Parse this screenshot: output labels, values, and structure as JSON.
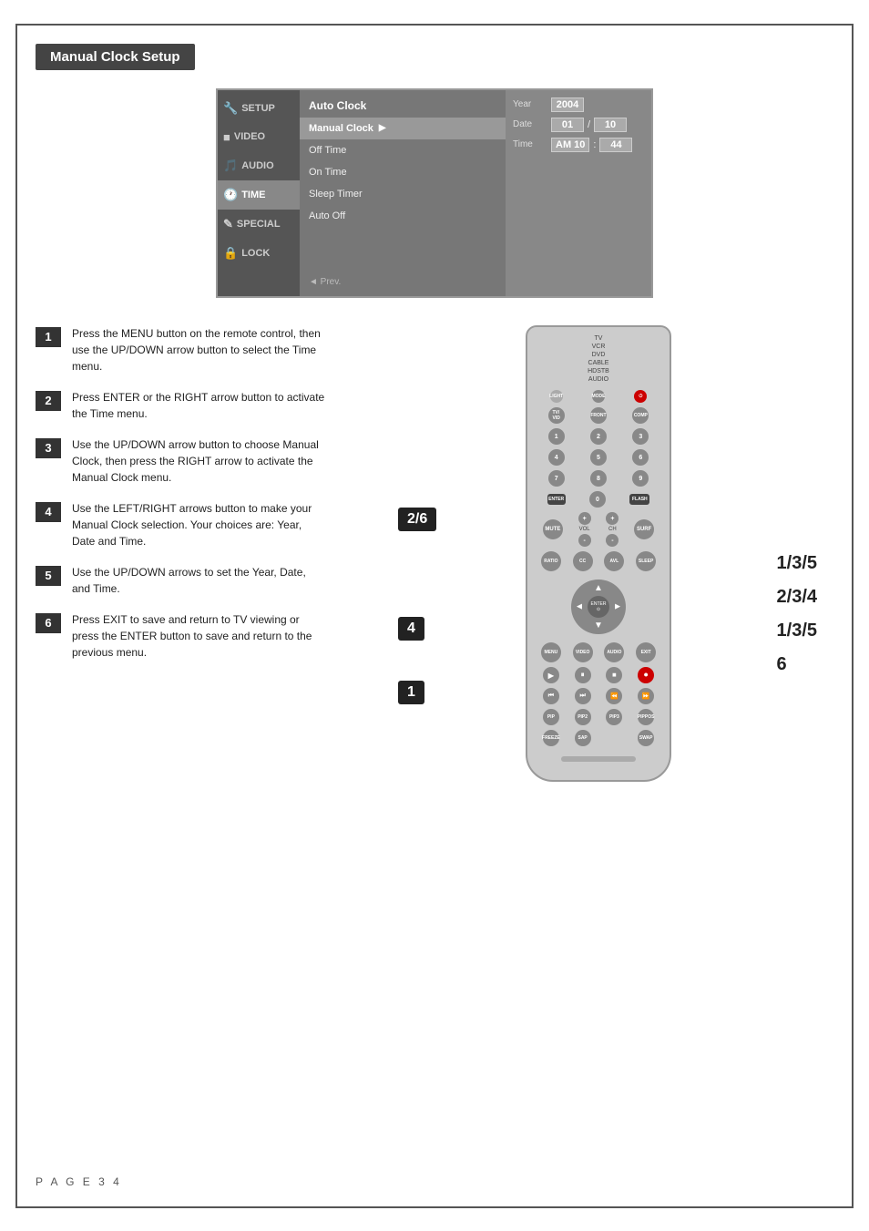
{
  "page": {
    "title": "Manual Clock Setup",
    "footer": "P A G E   3 4"
  },
  "tv_menu": {
    "sidebar_items": [
      {
        "label": "SETUP",
        "icon": "🔧",
        "active": false
      },
      {
        "label": "VIDEO",
        "icon": "■",
        "active": false
      },
      {
        "label": "AUDIO",
        "icon": "🎵",
        "active": false
      },
      {
        "label": "TIME",
        "icon": "🕐",
        "active": true
      },
      {
        "label": "SPECIAL",
        "icon": "✎",
        "active": false
      },
      {
        "label": "LOCK",
        "icon": "🔒",
        "active": false
      }
    ],
    "menu_items": [
      {
        "label": "Auto Clock",
        "active": true,
        "arrow": false
      },
      {
        "label": "Manual Clock",
        "active": false,
        "arrow": true
      },
      {
        "label": "Off Time",
        "active": false,
        "arrow": false
      },
      {
        "label": "On Time",
        "active": false,
        "arrow": false
      },
      {
        "label": "Sleep Timer",
        "active": false,
        "arrow": false
      },
      {
        "label": "Auto Off",
        "active": false,
        "arrow": false
      }
    ],
    "prev_label": "◄ Prev.",
    "settings": {
      "year_label": "Year",
      "year_value": "2004",
      "date_label": "Date",
      "date_value1": "01",
      "date_sep": "/",
      "date_value2": "10",
      "time_label": "Time",
      "time_value1": "AM 10",
      "time_sep": ":",
      "time_value2": "44"
    }
  },
  "steps": [
    {
      "number": "1",
      "text": "Press the MENU button on the remote control, then use the UP/DOWN arrow button to select the Time menu."
    },
    {
      "number": "2",
      "text": "Press ENTER or the RIGHT arrow button to activate the Time menu."
    },
    {
      "number": "3",
      "text": "Use the UP/DOWN arrow button to choose Manual Clock, then press the RIGHT arrow to activate the Manual Clock menu."
    },
    {
      "number": "4",
      "text": "Use the LEFT/RIGHT arrows button to make your Manual Clock selection. Your choices are: Year, Date and Time."
    },
    {
      "number": "5",
      "text": "Use the UP/DOWN arrows to set the Year, Date, and Time."
    },
    {
      "number": "6",
      "text": "Press EXIT to save and return to TV viewing or press the ENTER button to save and return to the previous menu."
    }
  ],
  "remote_callouts": {
    "callout_26": "2/6",
    "callout_4": "4",
    "callout_1": "1",
    "side_135a": "1/3/5",
    "side_234": "2/3/4",
    "side_135b": "1/3/5",
    "side_6": "6"
  },
  "remote": {
    "top_labels": [
      "TV",
      "VCR",
      "DVD",
      "CABLE",
      "HDSTB",
      "AUDIO"
    ],
    "buttons": {
      "enter": "ENTER",
      "menu": "MENU",
      "exit": "EXIT",
      "video": "VIDEO",
      "audio": "AUDIO",
      "play": "PLAY",
      "pause": "PAUSE",
      "stop": "STOP",
      "record": "RECORD",
      "rew": "REW",
      "ff": "FF",
      "mute": "MUTE",
      "freeze": "FREEZE",
      "swap": "SWAP"
    }
  }
}
